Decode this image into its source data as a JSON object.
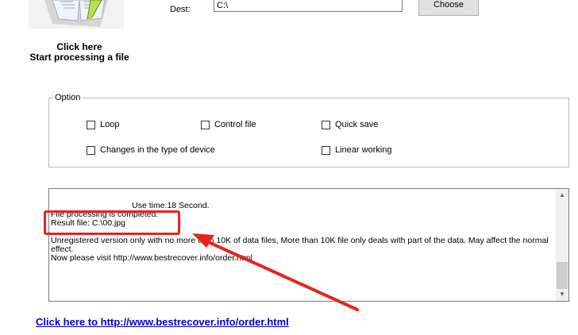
{
  "start": {
    "line1": "Click here",
    "line2": "Start processing a file"
  },
  "dest": {
    "label": "Dest:",
    "value": "C:\\",
    "choose_label": "Choose"
  },
  "options": {
    "title": "Option",
    "items": [
      {
        "label": "Loop",
        "checked": false
      },
      {
        "label": "Control file",
        "checked": false
      },
      {
        "label": "Quick save",
        "checked": false
      },
      {
        "label": "Changes in the type of device",
        "checked": false
      },
      {
        "label": "Linear working",
        "checked": false
      }
    ]
  },
  "log": {
    "lines": [
      "                                   Use time:18 Second.",
      "File processing is completed.",
      "Result file: C:\\00.jpg",
      "",
      "Unregistered version only with no more than 10K of data files, More than 10K file only deals with part of the data. May affect the normal effect.",
      "Now please visit http://www.bestrecover.info/order.html"
    ]
  },
  "order_link": "Click here to http://www.bestrecover.info/order.html",
  "colors": {
    "highlight": "#e8231e",
    "link": "#0000cc"
  },
  "icons": [
    "book-icon",
    "pencil-icon",
    "arrow-annotation-icon",
    "scroll-up-icon",
    "scroll-down-icon"
  ]
}
